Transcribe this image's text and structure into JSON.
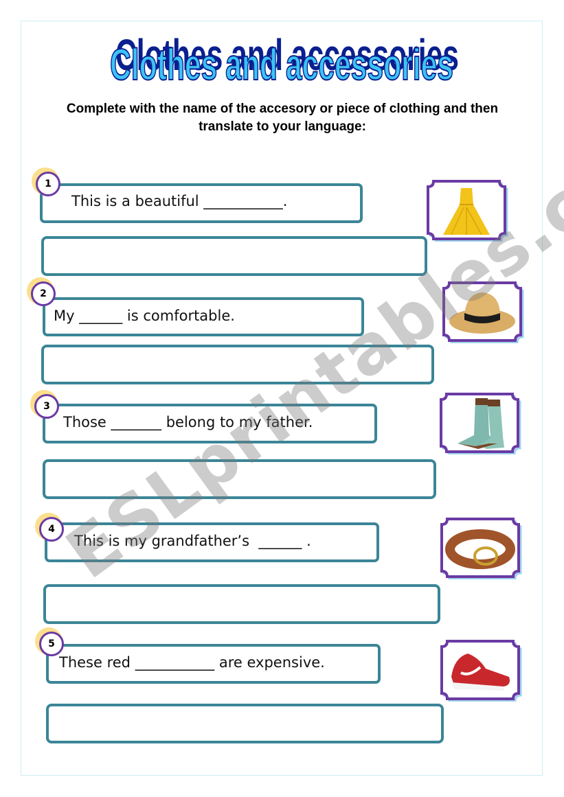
{
  "title": "Clothes and accessories",
  "instructions": {
    "line1": "Complete with the name of the accesory or piece of clothing and then",
    "line2": "translate to your language:"
  },
  "exercises": [
    {
      "number": "1",
      "sentence": "This is a beautiful ___________.",
      "image": "yellow-dress",
      "answer": "",
      "translation": ""
    },
    {
      "number": "2",
      "sentence": "My ______ is comfortable.",
      "image": "straw-hat",
      "answer": "",
      "translation": ""
    },
    {
      "number": "3",
      "sentence": "Those _______ belong to my father.",
      "image": "cowboy-boots",
      "answer": "",
      "translation": ""
    },
    {
      "number": "4",
      "sentence": "This is my grandfather’s  ______ .",
      "image": "leather-belt",
      "answer": "",
      "translation": ""
    },
    {
      "number": "5",
      "sentence": "These red ___________ are expensive.",
      "image": "red-sneakers",
      "answer": "",
      "translation": ""
    }
  ],
  "watermark": "ESLprintables.com",
  "colors": {
    "title_fill": "#3cc3f5",
    "title_shadow": "#0a1f8f",
    "box_border": "#3b8597",
    "number_circle": "#6a3aa4",
    "number_shadow": "#fbdf8c",
    "frame_border": "#6a3aa4",
    "frame_shadow": "#9fd4ec"
  }
}
